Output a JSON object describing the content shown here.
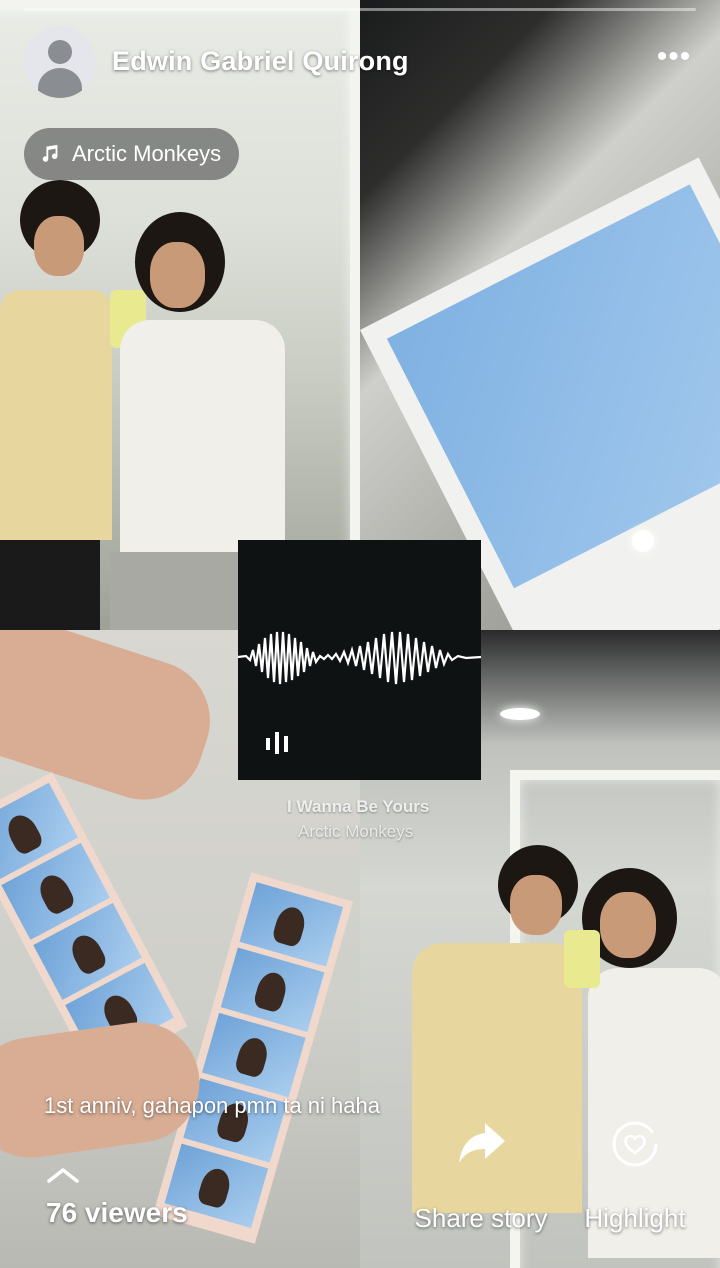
{
  "story": {
    "author": "Edwin Gabriel Quirong",
    "more_icon": "more-horizontal-icon",
    "music_icon": "music-note-icon",
    "music_label": "Arctic Monkeys",
    "song_title": "I Wanna Be Yours",
    "song_artist": "Arctic Monkeys",
    "caption": "1st anniv, gahapon pmn ta ni haha",
    "viewers": "76 viewers",
    "share_label": "Share story",
    "highlight_label": "Highlight",
    "accent": "#ffffff"
  }
}
